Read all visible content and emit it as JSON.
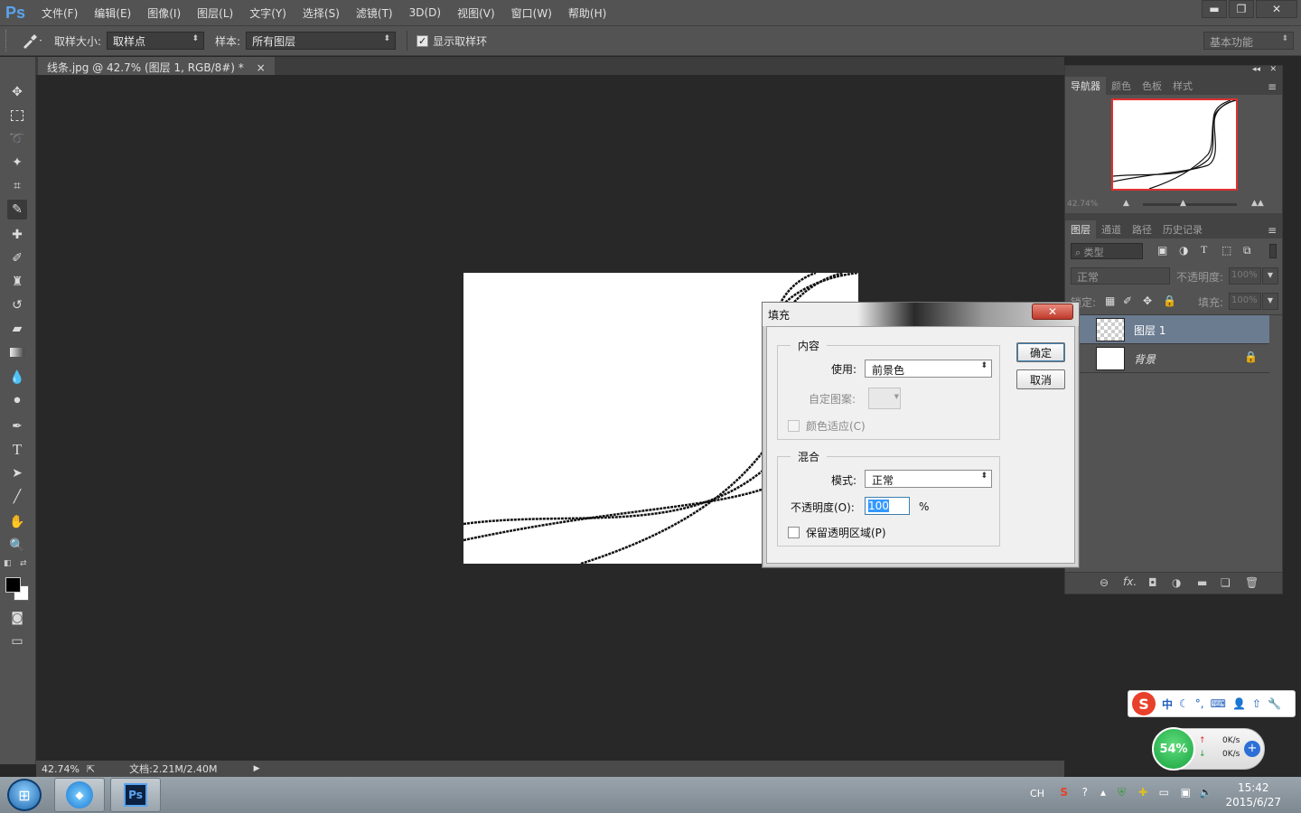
{
  "app": {
    "logo": "Ps",
    "menu": [
      "文件(F)",
      "编辑(E)",
      "图像(I)",
      "图层(L)",
      "文字(Y)",
      "选择(S)",
      "滤镜(T)",
      "3D(D)",
      "视图(V)",
      "窗口(W)",
      "帮助(H)"
    ]
  },
  "options": {
    "sample_size_label": "取样大小:",
    "sample_size_value": "取样点",
    "sample_label": "样本:",
    "sample_value": "所有图层",
    "show_ring_label": "显示取样环",
    "show_ring_checked": true,
    "workspace": "基本功能"
  },
  "document": {
    "tab_title": "线条.jpg @ 42.7% (图层 1, RGB/8#) *",
    "tab_close": "×"
  },
  "status": {
    "zoom": "42.74%",
    "doc_info": "文档:2.21M/2.40M"
  },
  "navigator": {
    "tabs": [
      "导航器",
      "颜色",
      "色板",
      "样式"
    ],
    "zoom": "42.74%"
  },
  "layers_panel": {
    "tabs": [
      "图层",
      "通道",
      "路径",
      "历史记录"
    ],
    "filter_label": "类型",
    "blend_mode": "正常",
    "opacity_label": "不透明度:",
    "opacity_value": "100%",
    "lock_label": "锁定:",
    "fill_label": "填充:",
    "fill_value": "100%",
    "layers": [
      {
        "name": "图层 1",
        "selected": true,
        "locked": false
      },
      {
        "name": "背景",
        "selected": false,
        "locked": true
      }
    ],
    "fx_label": "fx."
  },
  "fill_dialog": {
    "title": "填充",
    "close": "✕",
    "content_group": "内容",
    "use_label": "使用:",
    "use_value": "前景色",
    "custom_pattern_label": "自定图案:",
    "color_adapt_label": "颜色适应(C)",
    "blend_group": "混合",
    "mode_label": "模式:",
    "mode_value": "正常",
    "opacity_label": "不透明度(O):",
    "opacity_value": "100",
    "opacity_unit": "%",
    "preserve_label": "保留透明区域(P)",
    "ok": "确定",
    "cancel": "取消"
  },
  "ime": {
    "logo": "S",
    "mode": "中"
  },
  "netmon": {
    "percent": "54%",
    "up": "0K/s",
    "down": "0K/s"
  },
  "taskbar": {
    "tray_lang": "CH",
    "time": "15:42",
    "date": "2015/6/27"
  }
}
